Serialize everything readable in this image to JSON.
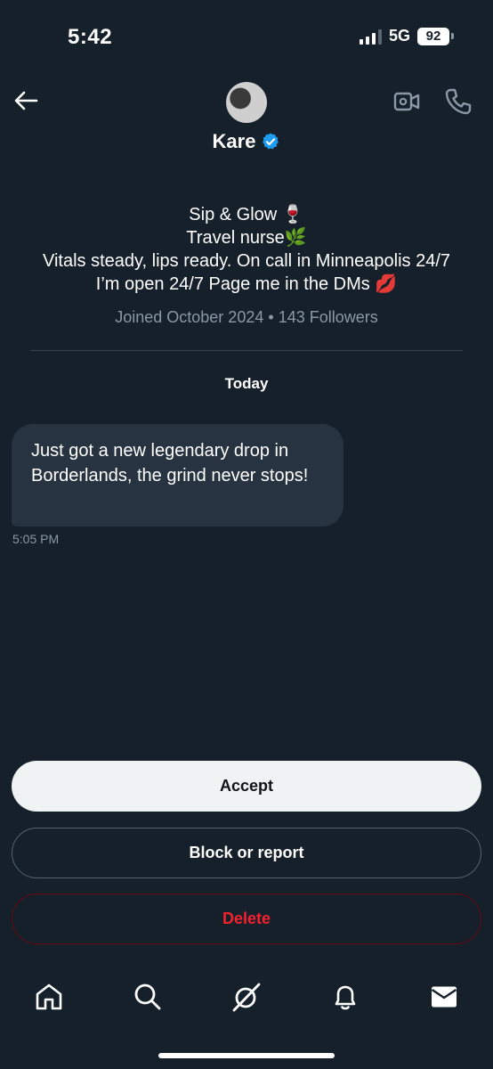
{
  "status_bar": {
    "time": "5:42",
    "network": "5G",
    "battery": "92"
  },
  "header": {
    "name": "Kare",
    "icons": {
      "back": "arrow-left-icon",
      "verified": "verified-badge-icon",
      "video": "video-call-icon",
      "phone": "phone-icon"
    },
    "accent_color": "#1d9bf0"
  },
  "profile": {
    "bio_lines": [
      "Sip & Glow 🍷",
      "Travel nurse🌿",
      "Vitals steady, lips ready. On call in Minneapolis 24/7",
      "I’m open 24/7 Page me in the DMs 💋"
    ],
    "joined": "Joined October 2024",
    "separator": "•",
    "followers": "143 Followers"
  },
  "conversation": {
    "date_label": "Today",
    "messages": [
      {
        "text": "Just got a new legendary drop in Borderlands, the grind never stops!",
        "time": "5:05 PM"
      }
    ]
  },
  "actions": {
    "accept": "Accept",
    "block": "Block or report",
    "delete": "Delete",
    "delete_color": "#f4212e"
  },
  "bottom_nav": {
    "items": [
      "home-icon",
      "search-icon",
      "grok-icon",
      "notifications-icon",
      "messages-icon"
    ]
  }
}
